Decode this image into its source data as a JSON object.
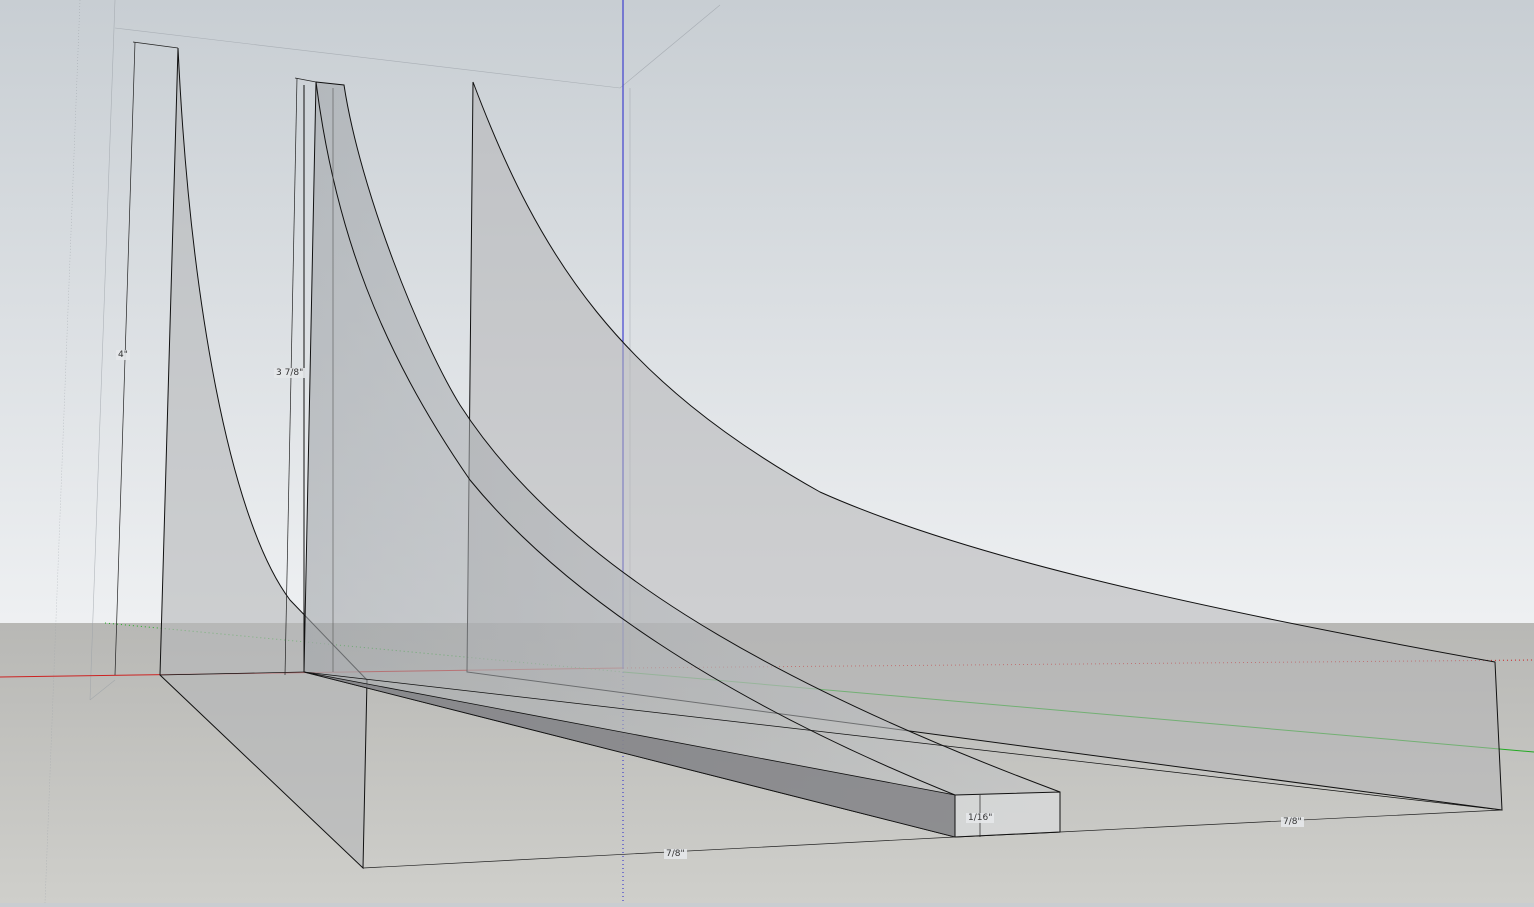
{
  "app": {
    "type": "3D modeling viewport"
  },
  "colors": {
    "sky_top": "#c8ced3",
    "sky_bottom": "#eef0f2",
    "ground": "#c8c8c4",
    "ground_top": "#b9b9b6",
    "face": "#b8b9bb",
    "face_dark": "#8a8b8d",
    "edge": "#111111",
    "axis_red": "#cc2222",
    "axis_green": "#22aa22",
    "axis_blue": "#2222cc"
  },
  "dimensions": {
    "height_4": "4\"",
    "height_3_7_8": "3 7/8\"",
    "thickness": "1/16\"",
    "width_bottom": "7/8\"",
    "width_right": "7/8\""
  }
}
